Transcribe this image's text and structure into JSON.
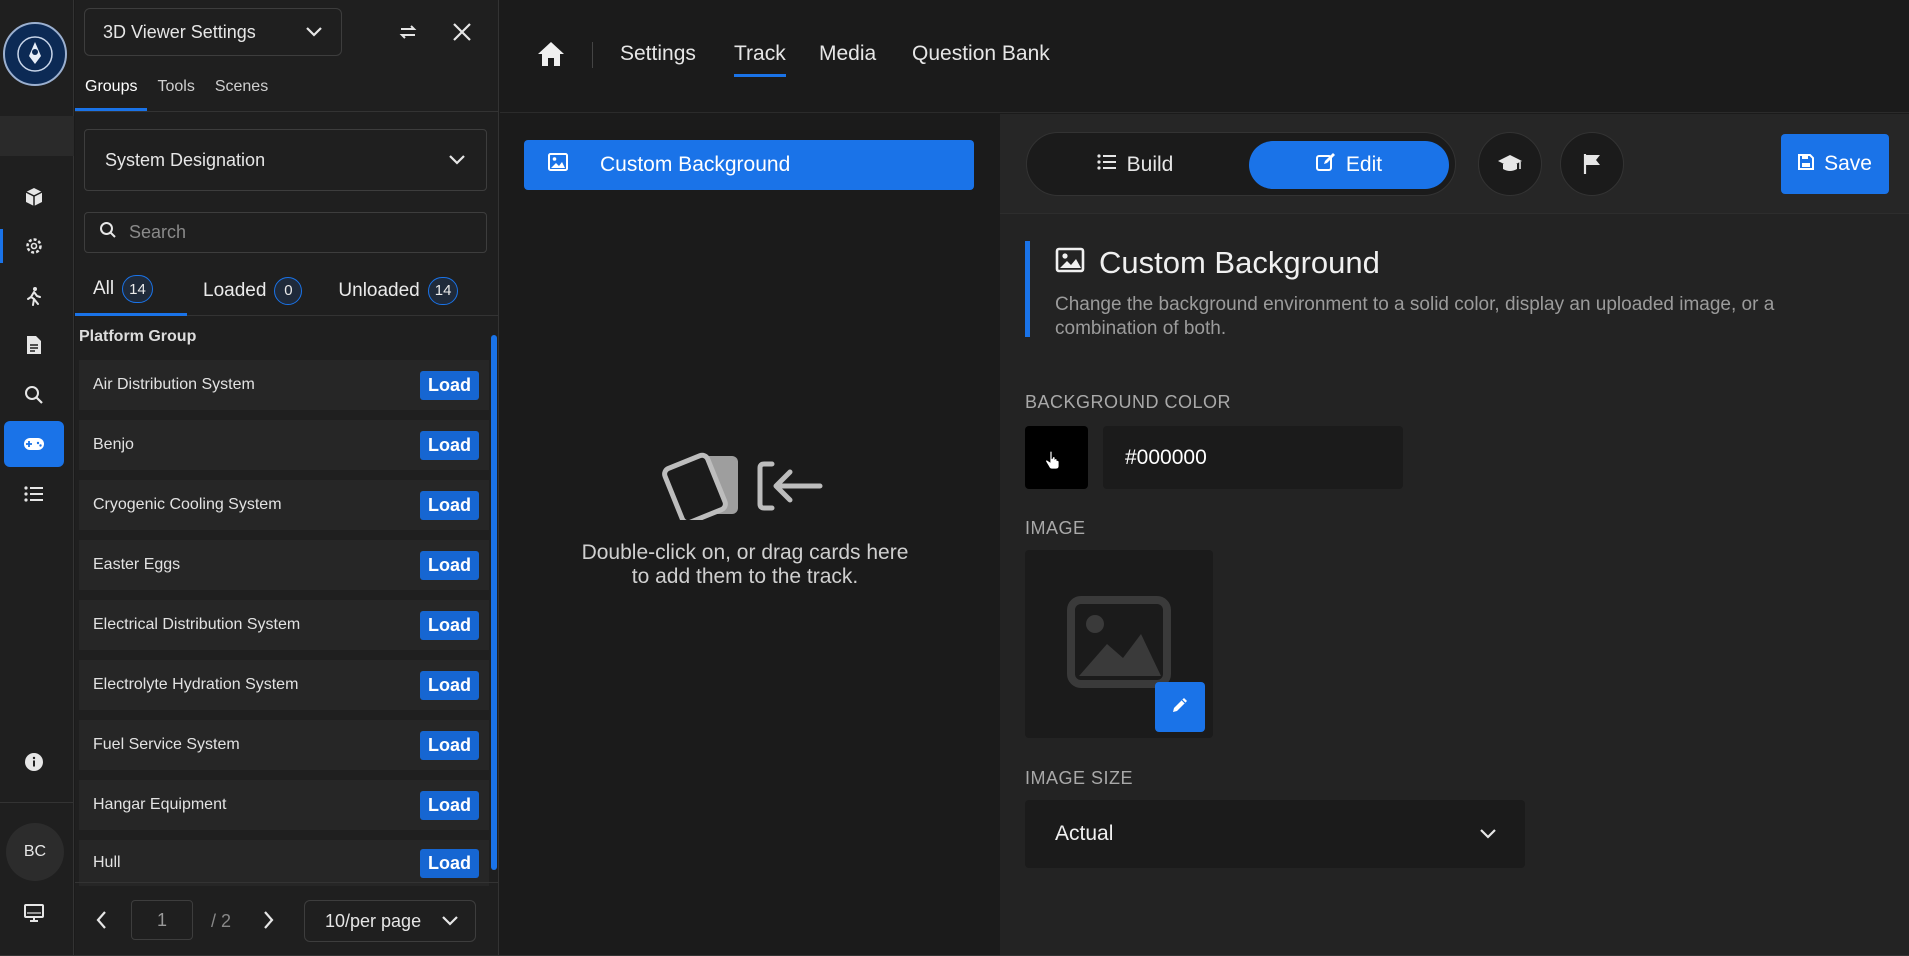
{
  "rail": {
    "logo_alt": "logo",
    "avatar": "BC"
  },
  "left_panel": {
    "viewer_dropdown": "3D Viewer Settings",
    "tabs": [
      {
        "label": "Groups"
      },
      {
        "label": "Tools"
      },
      {
        "label": "Scenes"
      }
    ],
    "designation_dropdown": "System Designation",
    "search_placeholder": "Search",
    "filters": [
      {
        "label": "All",
        "count": "14"
      },
      {
        "label": "Loaded",
        "count": "0"
      },
      {
        "label": "Unloaded",
        "count": "14"
      }
    ],
    "group_heading": "Platform Group",
    "items": [
      {
        "name": "Air Distribution System",
        "action": "Load"
      },
      {
        "name": "Benjo",
        "action": "Load"
      },
      {
        "name": "Cryogenic Cooling System",
        "action": "Load"
      },
      {
        "name": "Easter Eggs",
        "action": "Load"
      },
      {
        "name": "Electrical Distribution System",
        "action": "Load"
      },
      {
        "name": "Electrolyte Hydration System",
        "action": "Load"
      },
      {
        "name": "Fuel Service System",
        "action": "Load"
      },
      {
        "name": "Hangar Equipment",
        "action": "Load"
      },
      {
        "name": "Hull",
        "action": "Load"
      }
    ],
    "pager": {
      "page": "1",
      "total": "/ 2",
      "per_page": "10/per page"
    }
  },
  "topnav": {
    "items": [
      {
        "label": "Settings"
      },
      {
        "label": "Track"
      },
      {
        "label": "Media"
      },
      {
        "label": "Question Bank"
      }
    ]
  },
  "track": {
    "selected_card": "Custom Background",
    "empty_text": "Double-click on, or drag cards here to add them to the track."
  },
  "editor": {
    "build_label": "Build",
    "edit_label": "Edit",
    "save_label": "Save",
    "title": "Custom Background",
    "description": "Change the background environment to a solid color, display an uploaded image, or a combination of both.",
    "bg_color_label": "BACKGROUND COLOR",
    "bg_color_value": "#000000",
    "image_label": "IMAGE",
    "image_size_label": "IMAGE SIZE",
    "image_size_value": "Actual"
  },
  "colors": {
    "accent": "#1a73e8",
    "background": "#1b1b1b",
    "panel": "#232323"
  }
}
